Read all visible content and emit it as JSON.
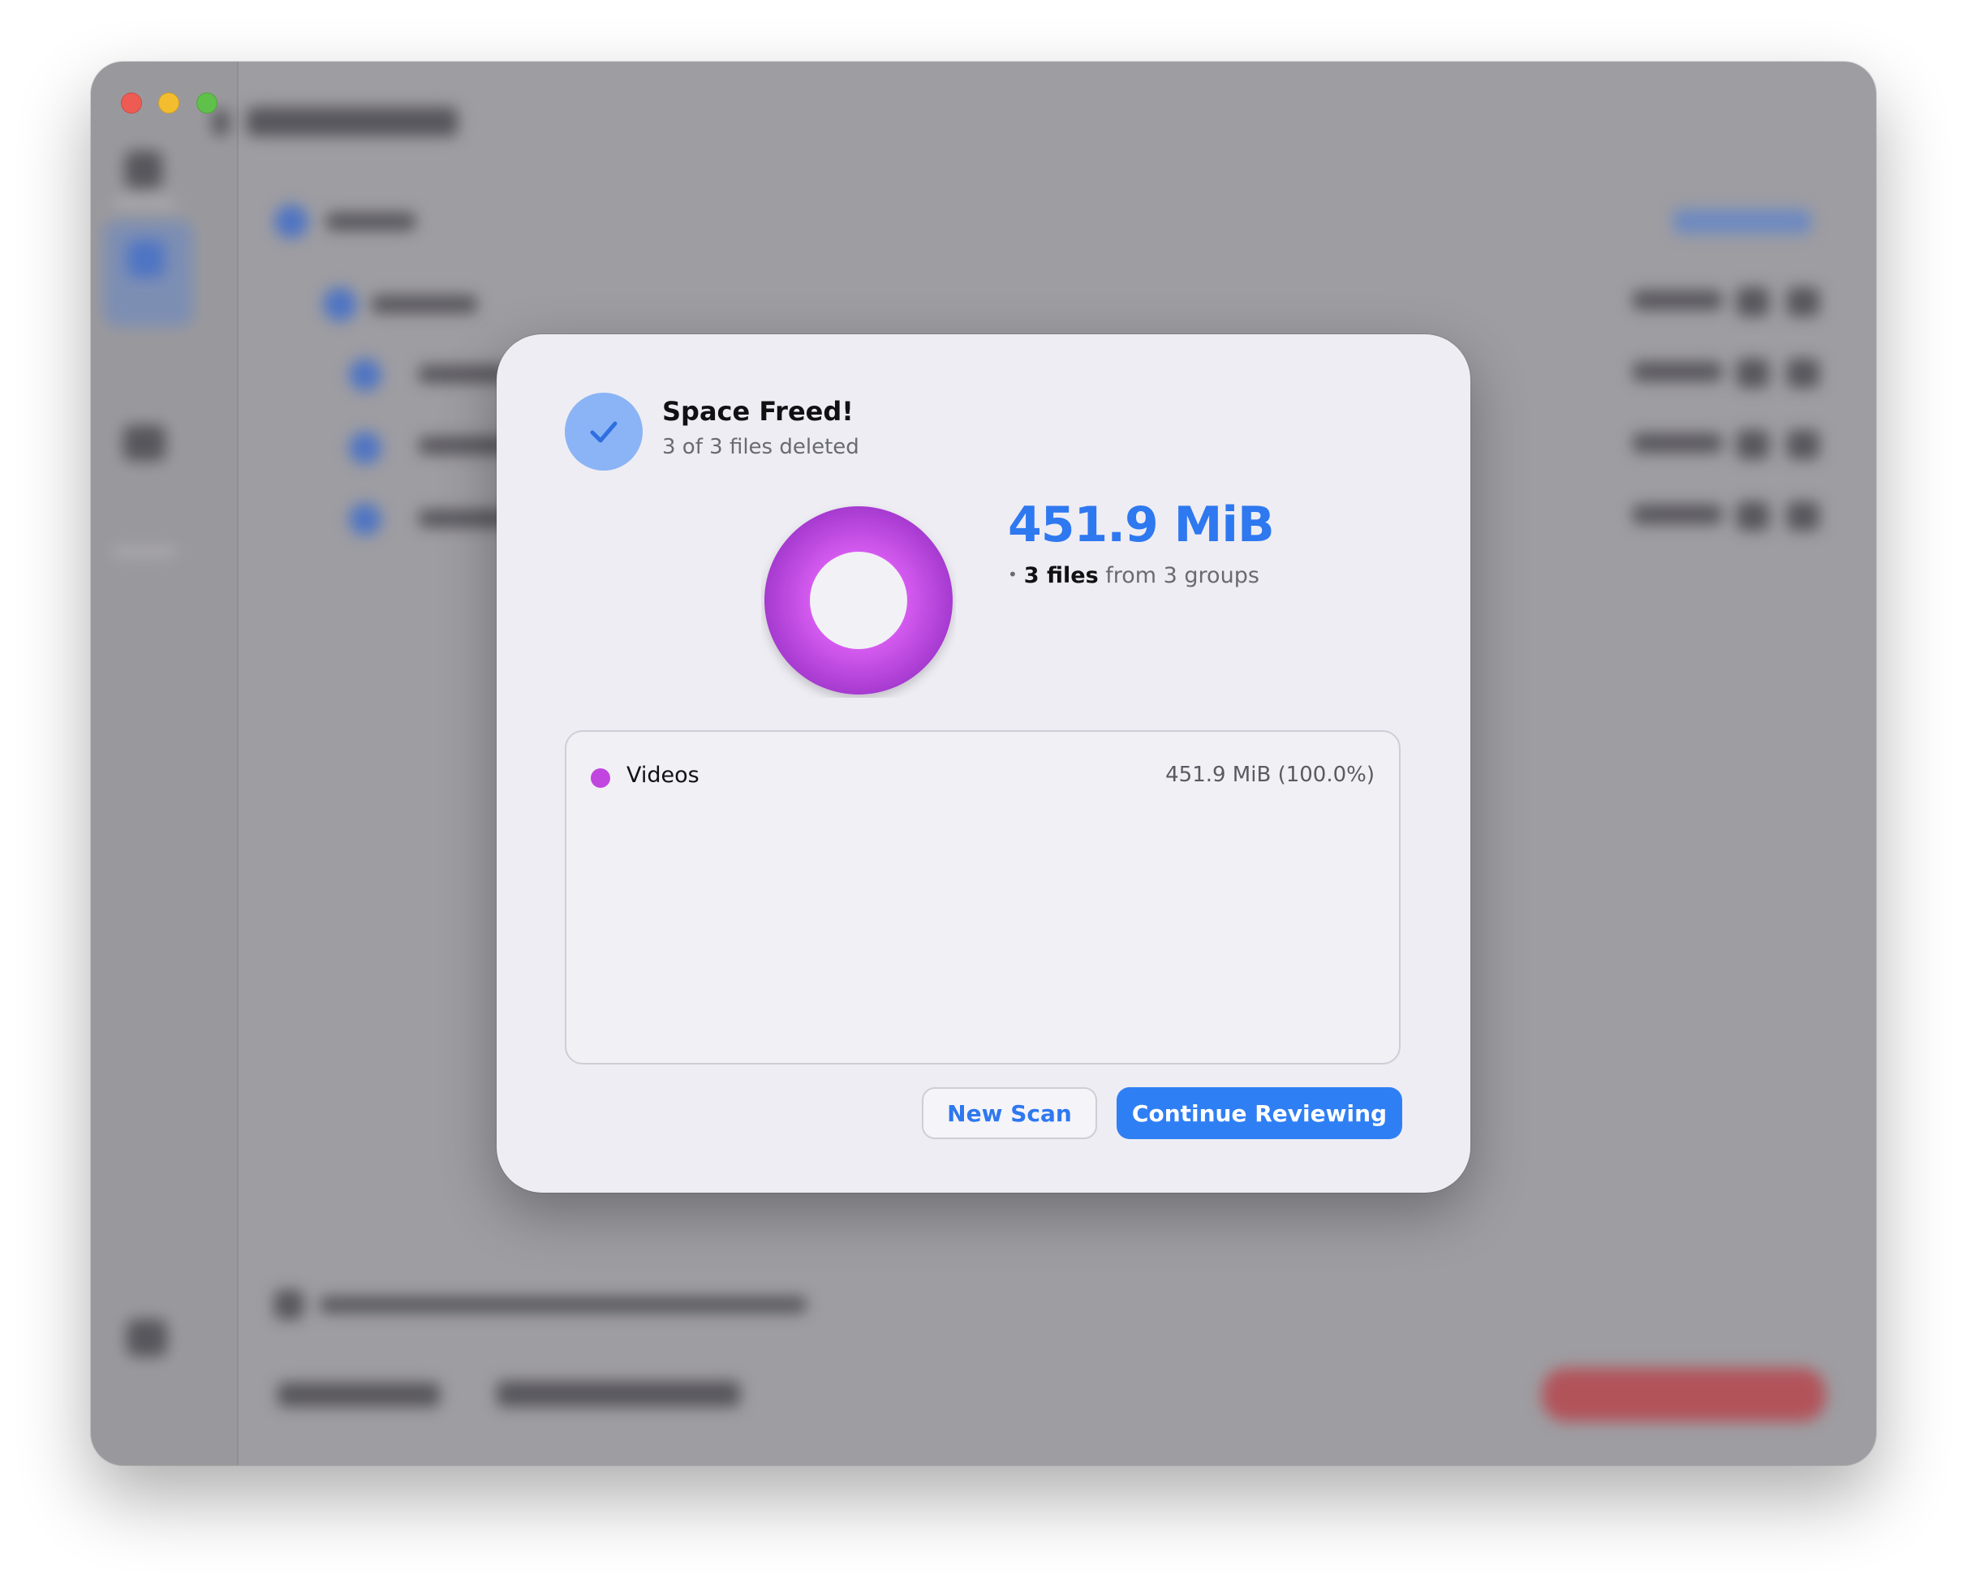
{
  "window": {
    "traffic_lights": [
      "close",
      "minimize",
      "zoom"
    ]
  },
  "dialog": {
    "icon": "checkmark-icon",
    "title": "Space Freed!",
    "subtitle": "3 of 3 files deleted",
    "freed_size": "451.9 MiB",
    "files_bullet": "•",
    "files_count": "3 files",
    "files_suffix": "from 3 groups",
    "chart_data": {
      "type": "pie",
      "style": "donut",
      "categories": [
        "Videos"
      ],
      "values": [
        451.9
      ],
      "unit": "MiB",
      "colors": [
        "#c146df"
      ]
    },
    "legend": [
      {
        "name": "Videos",
        "value": "451.9 MiB (100.0%)",
        "color": "#c146df"
      }
    ],
    "buttons": {
      "new_scan": "New Scan",
      "continue": "Continue Reviewing"
    }
  }
}
